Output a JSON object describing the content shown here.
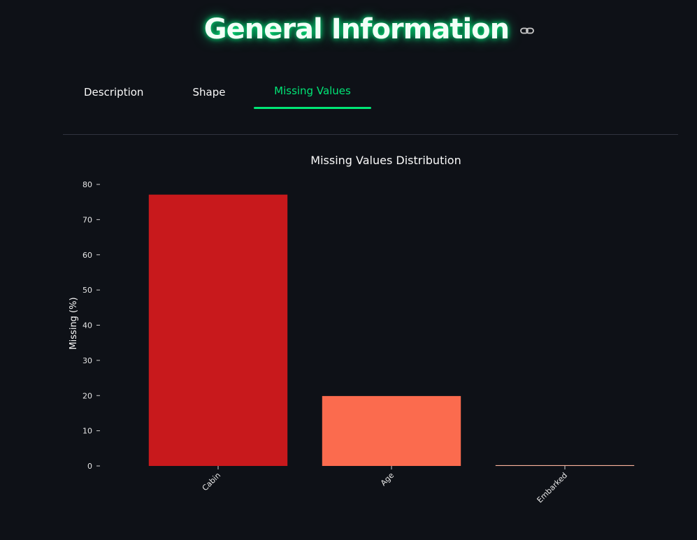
{
  "header": {
    "title": "General Information",
    "link_icon": "link-icon"
  },
  "tabs": [
    {
      "label": "Description",
      "active": false
    },
    {
      "label": "Shape",
      "active": false
    },
    {
      "label": "Missing Values",
      "active": true
    }
  ],
  "colors": {
    "background": "#0e1117",
    "accent": "#00e676",
    "title_glow": "#00ff88",
    "bar_cabin": "#c8191c",
    "bar_age": "#fb6b4e",
    "bar_embarked": "#fcb49c"
  },
  "chart_data": {
    "type": "bar",
    "title": "Missing Values Distribution",
    "xlabel": "",
    "ylabel": "Missing (%)",
    "categories": [
      "Cabin",
      "Age",
      "Embarked"
    ],
    "values": [
      77.1,
      19.87,
      0.22
    ],
    "colors": [
      "#c8191c",
      "#fb6b4e",
      "#fcb49c"
    ],
    "ylim": [
      0,
      80
    ],
    "yticks": [
      0,
      10,
      20,
      30,
      40,
      50,
      60,
      70,
      80
    ],
    "grid": false,
    "legend": "none"
  }
}
